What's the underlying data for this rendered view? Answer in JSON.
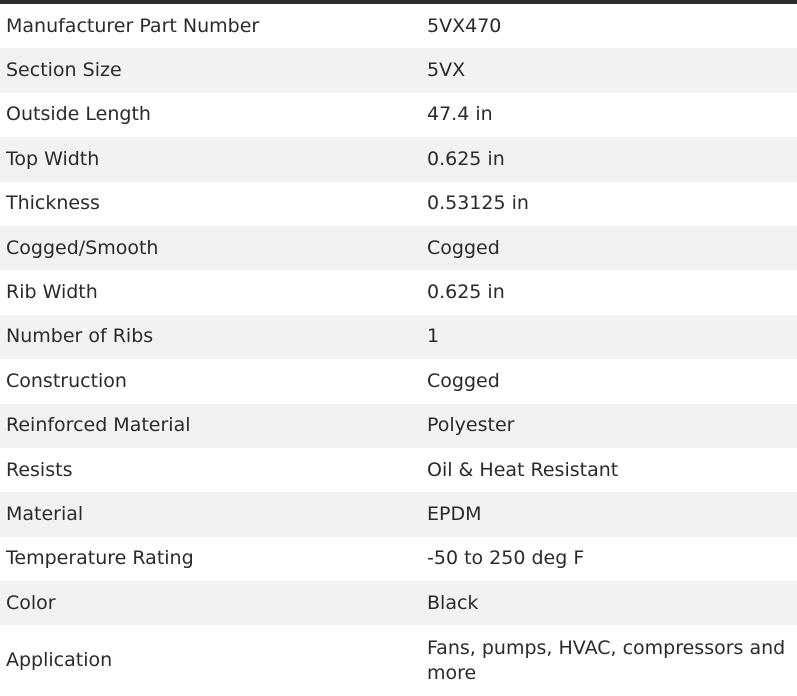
{
  "specs": [
    {
      "name": "Manufacturer Part Number",
      "value": "5VX470"
    },
    {
      "name": "Section Size",
      "value": "5VX"
    },
    {
      "name": "Outside Length",
      "value": "47.4 in"
    },
    {
      "name": "Top Width",
      "value": "0.625 in"
    },
    {
      "name": "Thickness",
      "value": "0.53125 in"
    },
    {
      "name": "Cogged/Smooth",
      "value": "Cogged"
    },
    {
      "name": "Rib Width",
      "value": "0.625 in"
    },
    {
      "name": "Number of Ribs",
      "value": "1"
    },
    {
      "name": "Construction",
      "value": "Cogged"
    },
    {
      "name": "Reinforced Material",
      "value": "Polyester"
    },
    {
      "name": "Resists",
      "value": "Oil & Heat Resistant"
    },
    {
      "name": "Material",
      "value": "EPDM"
    },
    {
      "name": "Temperature Rating",
      "value": "-50 to 250 deg F"
    },
    {
      "name": "Color",
      "value": "Black"
    },
    {
      "name": "Application",
      "value": "Fans, pumps, HVAC, compressors and more"
    }
  ]
}
